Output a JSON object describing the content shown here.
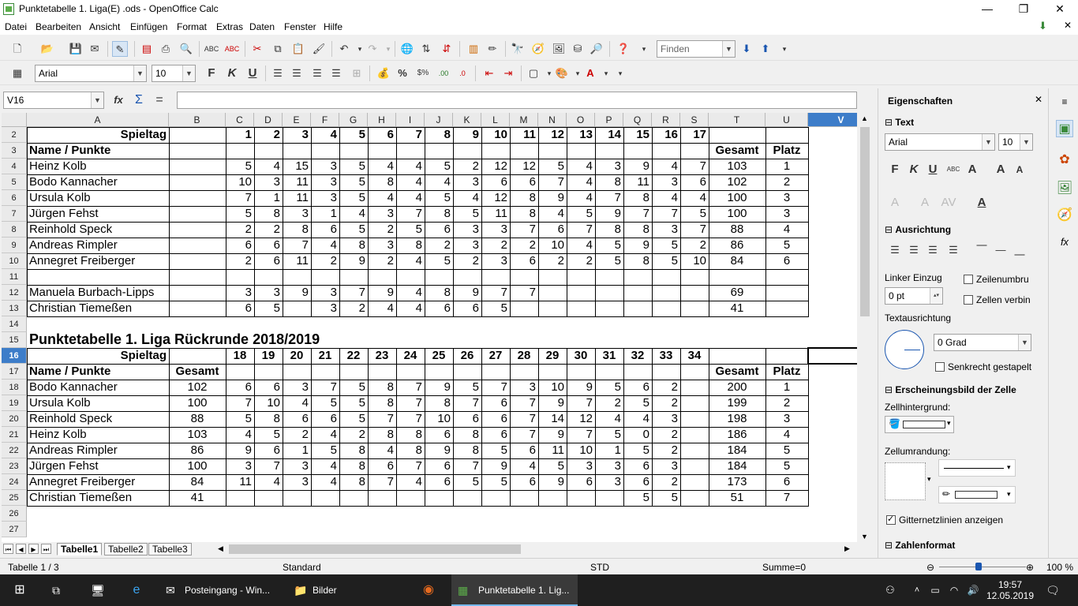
{
  "window": {
    "title": "Punktetabelle 1. Liga(E) .ods - OpenOffice Calc",
    "minimize": "—",
    "restore": "❐",
    "close": "✕"
  },
  "menu": [
    "Datei",
    "Bearbeiten",
    "Ansicht",
    "Einfügen",
    "Format",
    "Extras",
    "Daten",
    "Fenster",
    "Hilfe"
  ],
  "toolbar": {
    "find_placeholder": "Finden",
    "font_name": "Arial",
    "font_size": "10",
    "bold": "F",
    "italic": "K",
    "underline": "U"
  },
  "formula": {
    "name_box": "V16",
    "function_symbol": "fx",
    "sum_symbol": "Σ",
    "equals_symbol": "="
  },
  "columns": [
    "A",
    "B",
    "C",
    "D",
    "E",
    "F",
    "G",
    "H",
    "I",
    "J",
    "K",
    "L",
    "M",
    "N",
    "O",
    "P",
    "Q",
    "R",
    "S",
    "T",
    "U",
    "V"
  ],
  "rows": [
    "2",
    "3",
    "4",
    "5",
    "6",
    "7",
    "8",
    "9",
    "10",
    "11",
    "12",
    "13",
    "14",
    "15",
    "16",
    "17",
    "18",
    "19",
    "20",
    "21",
    "22",
    "23",
    "24",
    "25",
    "26",
    "27"
  ],
  "sheet": {
    "hin": {
      "spieltag_label": "Spieltag",
      "days": [
        "1",
        "2",
        "3",
        "4",
        "5",
        "6",
        "7",
        "8",
        "9",
        "10",
        "11",
        "12",
        "13",
        "14",
        "15",
        "16",
        "17"
      ],
      "name_header": "Name / Punkte",
      "gesamt_header": "Gesamt",
      "platz_header": "Platz",
      "players": [
        {
          "name": "Heinz Kolb",
          "pts": [
            "5",
            "4",
            "15",
            "3",
            "5",
            "4",
            "4",
            "5",
            "2",
            "12",
            "12",
            "5",
            "4",
            "3",
            "9",
            "4",
            "7"
          ],
          "gesamt": "103",
          "platz": "1"
        },
        {
          "name": "Bodo Kannacher",
          "pts": [
            "10",
            "3",
            "11",
            "3",
            "5",
            "8",
            "4",
            "4",
            "3",
            "6",
            "6",
            "7",
            "4",
            "8",
            "11",
            "3",
            "6"
          ],
          "gesamt": "102",
          "platz": "2"
        },
        {
          "name": "Ursula Kolb",
          "pts": [
            "7",
            "1",
            "11",
            "3",
            "5",
            "4",
            "4",
            "5",
            "4",
            "12",
            "8",
            "9",
            "4",
            "7",
            "8",
            "4",
            "4"
          ],
          "gesamt": "100",
          "platz": "3"
        },
        {
          "name": "Jürgen Fehst",
          "pts": [
            "5",
            "8",
            "3",
            "1",
            "4",
            "3",
            "7",
            "8",
            "5",
            "11",
            "8",
            "4",
            "5",
            "9",
            "7",
            "7",
            "5"
          ],
          "gesamt": "100",
          "platz": "3"
        },
        {
          "name": "Reinhold Speck",
          "pts": [
            "2",
            "2",
            "8",
            "6",
            "5",
            "2",
            "5",
            "6",
            "3",
            "3",
            "7",
            "6",
            "7",
            "8",
            "8",
            "3",
            "7"
          ],
          "gesamt": "88",
          "platz": "4"
        },
        {
          "name": "Andreas Rimpler",
          "pts": [
            "6",
            "6",
            "7",
            "4",
            "8",
            "3",
            "8",
            "2",
            "3",
            "2",
            "2",
            "10",
            "4",
            "5",
            "9",
            "5",
            "2"
          ],
          "gesamt": "86",
          "platz": "5"
        },
        {
          "name": "Annegret Freiberger",
          "pts": [
            "2",
            "6",
            "11",
            "2",
            "9",
            "2",
            "4",
            "5",
            "2",
            "3",
            "6",
            "2",
            "2",
            "5",
            "8",
            "5",
            "10"
          ],
          "gesamt": "84",
          "platz": "6"
        }
      ],
      "extra": [
        {
          "name": "Manuela Burbach-Lipps",
          "pts": [
            "3",
            "3",
            "9",
            "3",
            "7",
            "9",
            "4",
            "8",
            "9",
            "7",
            "7",
            "",
            "",
            "",
            "",
            "",
            ""
          ],
          "gesamt": "69",
          "platz": ""
        },
        {
          "name": "Christian Tiemeßen",
          "pts": [
            "6",
            "5",
            "",
            "3",
            "2",
            "4",
            "4",
            "6",
            "6",
            "5",
            "",
            "",
            "",
            "",
            "",
            "",
            ""
          ],
          "gesamt": "41",
          "platz": ""
        }
      ]
    },
    "rueck": {
      "title": "Punktetabelle 1. Liga Rückrunde 2018/2019",
      "spieltag_label": "Spieltag",
      "days": [
        "18",
        "19",
        "20",
        "21",
        "22",
        "23",
        "24",
        "25",
        "26",
        "27",
        "28",
        "29",
        "30",
        "31",
        "32",
        "33",
        "34"
      ],
      "name_header": "Name / Punkte",
      "gesamt_b_header": "Gesamt",
      "gesamt_header": "Gesamt",
      "platz_header": "Platz",
      "players": [
        {
          "name": "Bodo Kannacher",
          "b": "102",
          "pts": [
            "6",
            "6",
            "3",
            "7",
            "5",
            "8",
            "7",
            "9",
            "5",
            "7",
            "3",
            "10",
            "9",
            "5",
            "6",
            "2",
            ""
          ],
          "gesamt": "200",
          "platz": "1"
        },
        {
          "name": "Ursula Kolb",
          "b": "100",
          "pts": [
            "7",
            "10",
            "4",
            "5",
            "5",
            "8",
            "7",
            "8",
            "7",
            "6",
            "7",
            "9",
            "7",
            "2",
            "5",
            "2",
            ""
          ],
          "gesamt": "199",
          "platz": "2"
        },
        {
          "name": "Reinhold Speck",
          "b": "88",
          "pts": [
            "5",
            "8",
            "6",
            "6",
            "5",
            "7",
            "7",
            "10",
            "6",
            "6",
            "7",
            "14",
            "12",
            "4",
            "4",
            "3",
            ""
          ],
          "gesamt": "198",
          "platz": "3"
        },
        {
          "name": "Heinz Kolb",
          "b": "103",
          "pts": [
            "4",
            "5",
            "2",
            "4",
            "2",
            "8",
            "8",
            "6",
            "8",
            "6",
            "7",
            "9",
            "7",
            "5",
            "0",
            "2",
            ""
          ],
          "gesamt": "186",
          "platz": "4"
        },
        {
          "name": "Andreas Rimpler",
          "b": "86",
          "pts": [
            "9",
            "6",
            "1",
            "5",
            "8",
            "4",
            "8",
            "9",
            "8",
            "5",
            "6",
            "11",
            "10",
            "1",
            "5",
            "2",
            ""
          ],
          "gesamt": "184",
          "platz": "5"
        },
        {
          "name": "Jürgen Fehst",
          "b": "100",
          "pts": [
            "3",
            "7",
            "3",
            "4",
            "8",
            "6",
            "7",
            "6",
            "7",
            "9",
            "4",
            "5",
            "3",
            "3",
            "6",
            "3",
            ""
          ],
          "gesamt": "184",
          "platz": "5"
        },
        {
          "name": "Annegret Freiberger",
          "b": "84",
          "pts": [
            "11",
            "4",
            "3",
            "4",
            "8",
            "7",
            "4",
            "6",
            "5",
            "5",
            "6",
            "9",
            "6",
            "3",
            "6",
            "2",
            ""
          ],
          "gesamt": "173",
          "platz": "6"
        },
        {
          "name": "Christian Tiemeßen",
          "b": "41",
          "pts": [
            "",
            "",
            "",
            "",
            "",
            "",
            "",
            "",
            "",
            "",
            "",
            "",
            "",
            "",
            "5",
            "5",
            ""
          ],
          "gesamt": "51",
          "platz": "7"
        }
      ]
    }
  },
  "tabs": [
    "Tabelle1",
    "Tabelle2",
    "Tabelle3"
  ],
  "status": {
    "sheet": "Tabelle 1 / 3",
    "style": "Standard",
    "mode": "STD",
    "sum": "Summe=0",
    "zoom": "100 %"
  },
  "sidebar": {
    "title": "Eigenschaften",
    "text_section": "Text",
    "font": "Arial",
    "size": "10",
    "align_section": "Ausrichtung",
    "indent_label": "Linker Einzug",
    "indent_value": "0 pt",
    "wrap_label": "Zeilenumbru",
    "merge_label": "Zellen verbin",
    "text_orientation_label": "Textausrichtung",
    "angle_value": "0 Grad",
    "vertical_stacked_label": "Senkrecht gestapelt",
    "cell_appearance_section": "Erscheinungsbild der Zelle",
    "background_label": "Zellhintergrund:",
    "border_label": "Zellumrandung:",
    "gridlines_label": "Gitternetzlinien anzeigen",
    "number_format_section": "Zahlenformat"
  },
  "taskbar": {
    "mail": "Posteingang - Win...",
    "files": "Bilder",
    "calc": "Punktetabelle 1. Lig...",
    "time": "19:57",
    "date": "12.05.2019"
  }
}
